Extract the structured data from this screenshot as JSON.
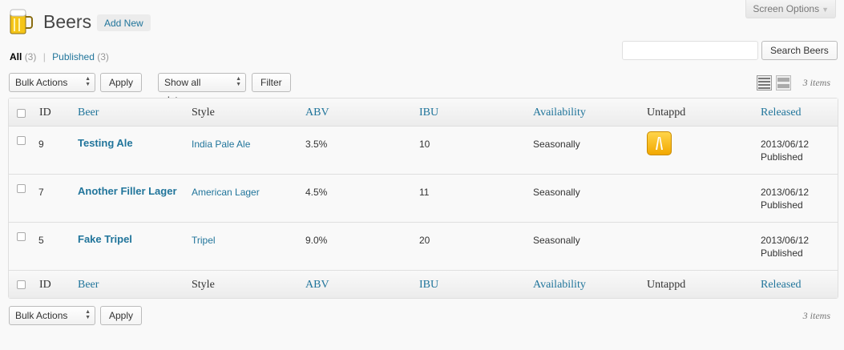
{
  "header": {
    "title": "Beers",
    "add_new": "Add New",
    "screen_options": "Screen Options"
  },
  "views": {
    "all_label": "All",
    "all_count": "(3)",
    "separator": "|",
    "published_label": "Published",
    "published_count": "(3)"
  },
  "search": {
    "value": "",
    "button": "Search Beers"
  },
  "top_nav": {
    "bulk_actions": "Bulk Actions",
    "apply": "Apply",
    "dates": "Show all dates",
    "filter": "Filter",
    "items_count": "3 items"
  },
  "bottom_nav": {
    "bulk_actions": "Bulk Actions",
    "apply": "Apply",
    "items_count": "3 items"
  },
  "columns": {
    "id": "ID",
    "beer": "Beer",
    "style": "Style",
    "abv": "ABV",
    "ibu": "IBU",
    "availability": "Availability",
    "untappd": "Untappd",
    "released": "Released"
  },
  "rows": [
    {
      "id": "9",
      "beer": "Testing Ale",
      "style": "India Pale Ale",
      "abv": "3.5%",
      "ibu": "10",
      "availability": "Seasonally",
      "untappd": true,
      "released_date": "2013/06/12",
      "released_status": "Published"
    },
    {
      "id": "7",
      "beer": "Another Filler Lager",
      "style": "American Lager",
      "abv": "4.5%",
      "ibu": "11",
      "availability": "Seasonally",
      "untappd": false,
      "released_date": "2013/06/12",
      "released_status": "Published"
    },
    {
      "id": "5",
      "beer": "Fake Tripel",
      "style": "Tripel",
      "abv": "9.0%",
      "ibu": "20",
      "availability": "Seasonally",
      "untappd": false,
      "released_date": "2013/06/12",
      "released_status": "Published"
    }
  ],
  "icons": {
    "page": "beer-mug-icon",
    "untappd": "untappd-icon",
    "list_view": "list-view-icon",
    "excerpt_view": "excerpt-view-icon"
  }
}
